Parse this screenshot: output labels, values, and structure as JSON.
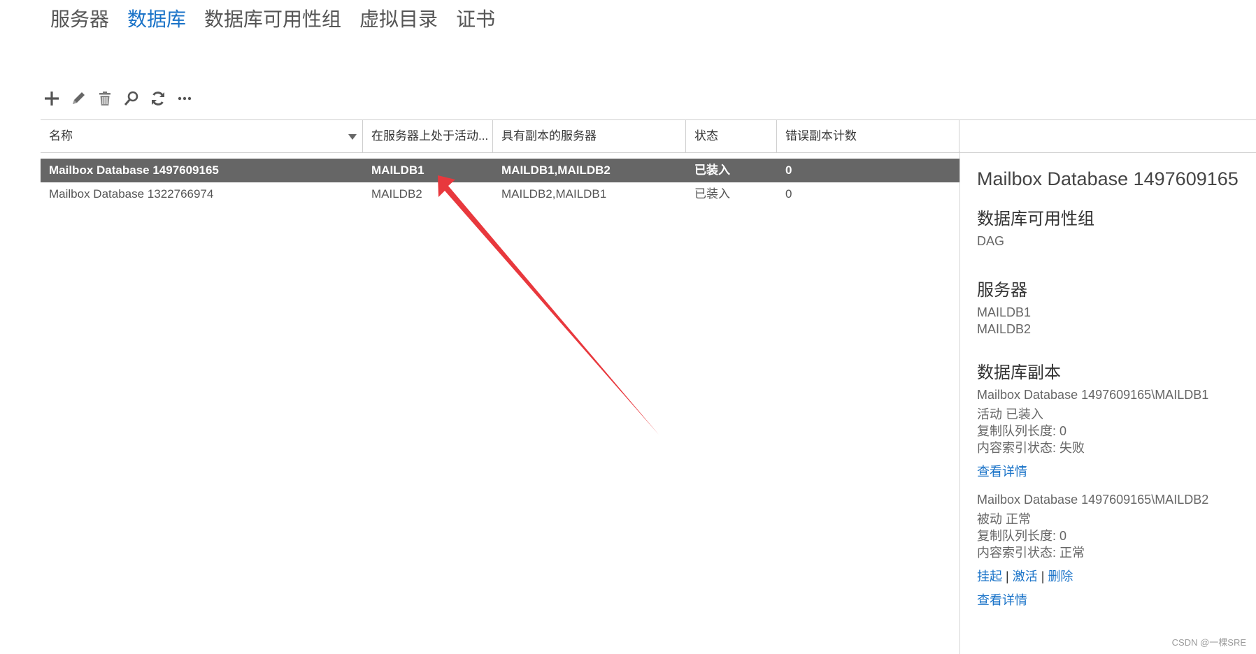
{
  "top_tabs": [
    {
      "label": "服务器",
      "active": false
    },
    {
      "label": "数据库",
      "active": true
    },
    {
      "label": "数据库可用性组",
      "active": false
    },
    {
      "label": "虚拟目录",
      "active": false
    },
    {
      "label": "证书",
      "active": false
    }
  ],
  "toolbar": {
    "icons": [
      "plus-icon",
      "pencil-icon",
      "trash-icon",
      "search-icon",
      "refresh-icon",
      "more-icon"
    ]
  },
  "grid": {
    "columns": [
      "名称",
      "在服务器上处于活动...",
      "具有副本的服务器",
      "状态",
      "错误副本计数"
    ],
    "rows": [
      {
        "name": "Mailbox Database 1497609165",
        "active_server": "MAILDB1",
        "replica_servers": "MAILDB1,MAILDB2",
        "status": "已装入",
        "bad_copy_count": "0",
        "selected": true
      },
      {
        "name": "Mailbox Database 1322766974",
        "active_server": "MAILDB2",
        "replica_servers": "MAILDB2,MAILDB1",
        "status": "已装入",
        "bad_copy_count": "0",
        "selected": false
      }
    ]
  },
  "details": {
    "title": "Mailbox Database 1497609165",
    "dag_heading": "数据库可用性组",
    "dag_value": "DAG",
    "servers_heading": "服务器",
    "servers": [
      "MAILDB1",
      "MAILDB2"
    ],
    "copies_heading": "数据库副本",
    "copy1": {
      "name": "Mailbox Database 1497609165\\MAILDB1",
      "state": " 活动 已装入",
      "queue": "复制队列长度: 0",
      "index": "内容索引状态: 失败",
      "view_details": "查看详情"
    },
    "copy2": {
      "name": "Mailbox Database 1497609165\\MAILDB2",
      "state": " 被动 正常",
      "queue": "复制队列长度: 0",
      "index": "内容索引状态: 正常",
      "actions": [
        "挂起",
        "激活",
        "删除"
      ],
      "separator": "|",
      "view_details": "查看详情"
    }
  },
  "annotation": {
    "color": "#e8383d"
  },
  "watermark": "CSDN @一棵SRE",
  "colors": {
    "accent": "#1a73c8",
    "selected_row": "#666666"
  }
}
